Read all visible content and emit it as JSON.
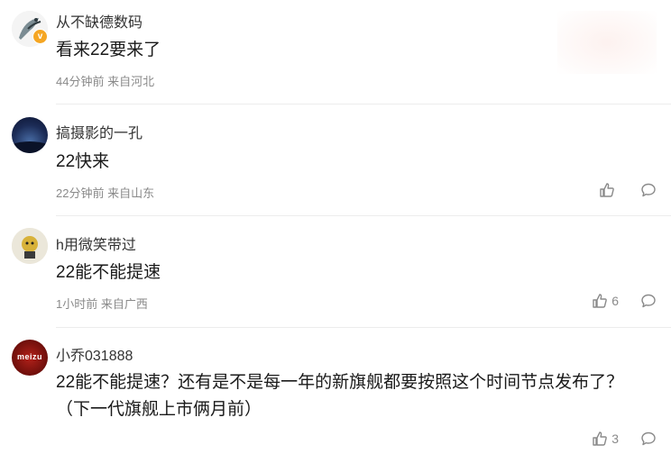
{
  "comments": [
    {
      "username": "从不缺德数码",
      "content": "看来22要来了",
      "time": "44分钟前",
      "location": "来自河北",
      "like_count": "",
      "verified": true
    },
    {
      "username": "搞摄影的一孔",
      "content": "22快来",
      "time": "22分钟前",
      "location": "来自山东",
      "like_count": ""
    },
    {
      "username": "h用微笑带过",
      "content": "22能不能提速",
      "time": "1小时前",
      "location": "来自广西",
      "like_count": "6"
    },
    {
      "username": "小乔031888",
      "content_line1": "22能不能提速？还有是不是每一年的新旗舰都要按照这个时间节点发布了？",
      "content_line2": "（下一代旗舰上市俩月前）",
      "avatar_text": "meizu",
      "like_count": "3"
    }
  ],
  "icons": {
    "like": "thumbs-up-icon",
    "reply": "speech-bubble-icon"
  },
  "colors": {
    "meta": "#8a8a8a",
    "divider": "#ececec",
    "verified": "#f5a623"
  }
}
